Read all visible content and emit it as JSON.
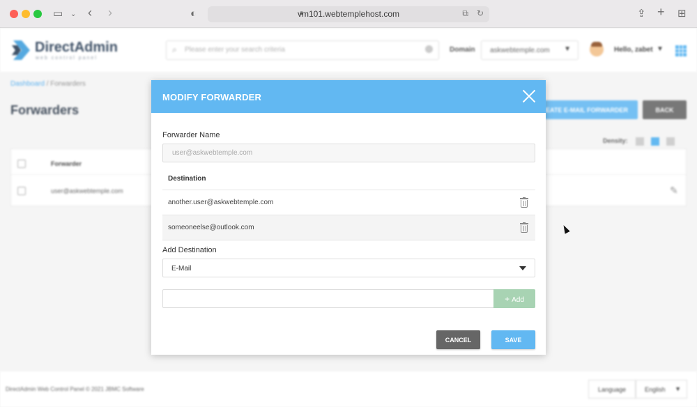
{
  "browser": {
    "url": "vm101.webtemplehost.com"
  },
  "app": {
    "logo_text": "DirectAdmin",
    "logo_sub": "web control panel",
    "search_placeholder": "Please enter your search criteria",
    "domain_label": "Domain",
    "domain_value": "askwebtemple.com",
    "user_greeting": "Hello, zabet",
    "breadcrumb_link": "Dashboard",
    "breadcrumb_current": " / Forwarders",
    "page_title": "Forwarders",
    "create_button": "CREATE E-MAIL FORWARDER",
    "back_button": "BACK",
    "density_label": "Density:",
    "table_header": "Forwarder",
    "table_row": "user@askwebtemple.com",
    "footer_text": "DirectAdmin Web Control Panel © 2021 JBMC Software",
    "language_button": "Language",
    "language_value": "English",
    "accent_color": "#62b8f2"
  },
  "modal": {
    "title": "MODIFY FORWARDER",
    "forwarder_name_label": "Forwarder Name",
    "forwarder_name_placeholder": "user@askwebtemple.com",
    "destination_header": "Destination",
    "destinations": [
      "another.user@askwebtemple.com",
      "someoneelse@outlook.com"
    ],
    "add_destination_label": "Add Destination",
    "destination_type": "E-Mail",
    "add_button": "Add",
    "cancel_button": "CANCEL",
    "save_button": "SAVE"
  }
}
